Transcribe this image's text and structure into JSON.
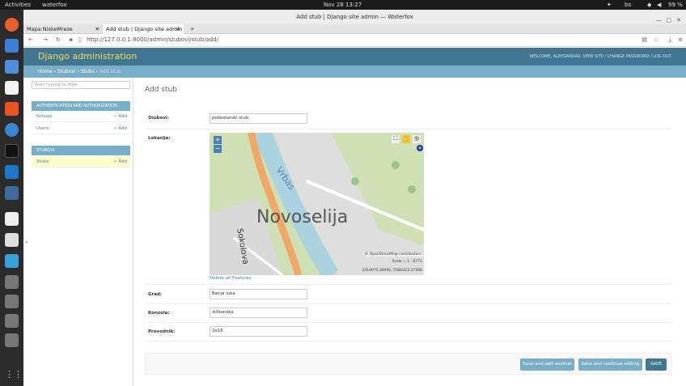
{
  "os": {
    "activities": "Activities",
    "app_name": "waterfox",
    "clock": "Nov 28  13:27",
    "lang": "bs",
    "battery": "99 %"
  },
  "browser": {
    "window_title": "Add stub | Django site admin — Waterfox",
    "tabs": [
      {
        "label": "Mapa NiskeMreze"
      },
      {
        "label": "Add stub | Django site admin"
      }
    ],
    "url": "http://127.0.0.1:8000/admin/stubovi/stub/add/"
  },
  "header": {
    "brand": "Django administration",
    "user_tools": "WELCOME, ALEKSANDAR. VIEW SITE / CHANGE PASSWORD / LOG OUT"
  },
  "breadcrumbs": {
    "home": "Home",
    "app": "Stubovi",
    "model": "Stubs",
    "current": "Add stub"
  },
  "sidebar": {
    "filter_placeholder": "Start typing to filter...",
    "modules": [
      {
        "title": "AUTHENTICATION AND AUTHORIZATION",
        "items": [
          {
            "label": "Groups",
            "add": "Add"
          },
          {
            "label": "Users",
            "add": "Add"
          }
        ]
      },
      {
        "title": "STUBOVI",
        "items": [
          {
            "label": "Stubs",
            "add": "Add"
          }
        ]
      }
    ],
    "collapse": "«"
  },
  "form": {
    "title": "Add stub",
    "stubovi_label": "Stubovi:",
    "stubovi_value": "poliesterski stub",
    "lokacija_label": "Lokacija:",
    "map_place": "Novoselija",
    "map_river": "Vrbas",
    "map_street": "Sokolova",
    "map_zoom_in": "+",
    "map_zoom_out": "−",
    "map_attribution": "© OpenStreetMap contributors.",
    "map_scale": "Scale = 1 : 6771",
    "map_coords": "2310075.39492, 5580323.57566",
    "delete_features": "Delete all Features",
    "grad_label": "Grad:",
    "grad_value": "Banja luka",
    "konzola_label": "Konzola:",
    "konzola_value": "silikonska",
    "provodnik_label": "Provodnik:",
    "provodnik_value": "2x16"
  },
  "buttons": {
    "save_add_another": "Save and add another",
    "save_continue": "Save and continue editing",
    "save": "SAVE"
  }
}
